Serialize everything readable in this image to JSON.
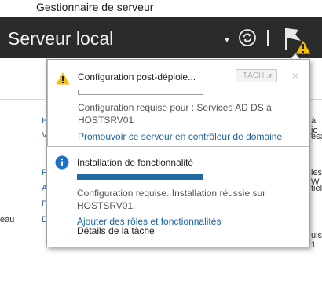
{
  "app": {
    "title": "Gestionnaire de serveur"
  },
  "header": {
    "title": "Serveur local",
    "icons": [
      "dropdown-arrow-icon",
      "refresh-icon",
      "notification-flag-icon",
      "warning-icon"
    ]
  },
  "background": {
    "letters_left": [
      "H",
      "V",
      "P",
      "A",
      "D",
      "D"
    ],
    "text_left": "eau",
    "text_right": [
      "à jo",
      "ésa",
      "ies W",
      "tiel",
      "uis 1"
    ]
  },
  "notifications": {
    "tasks": [
      {
        "icon": "warning-icon",
        "title": "Configuration post-déploie...",
        "progress": 0,
        "action_select": "TÂCH...",
        "close": "×",
        "description": "Configuration requise pour : Services AD DS à HOSTSRV01",
        "link": "Promouvoir ce serveur en contrôleur de domaine"
      },
      {
        "icon": "info-icon",
        "title": "Installation de fonctionnalité",
        "progress": 1,
        "description": "Configuration requise. Installation réussie sur HOSTSRV01.",
        "link": "Ajouter des rôles et fonctionnalités"
      }
    ],
    "footer": "Détails de la tâche"
  },
  "colors": {
    "header_bg": "#2b2b2b",
    "link": "#1a63a8",
    "progress": "#1f6aa0",
    "warning": "#f5c000"
  }
}
